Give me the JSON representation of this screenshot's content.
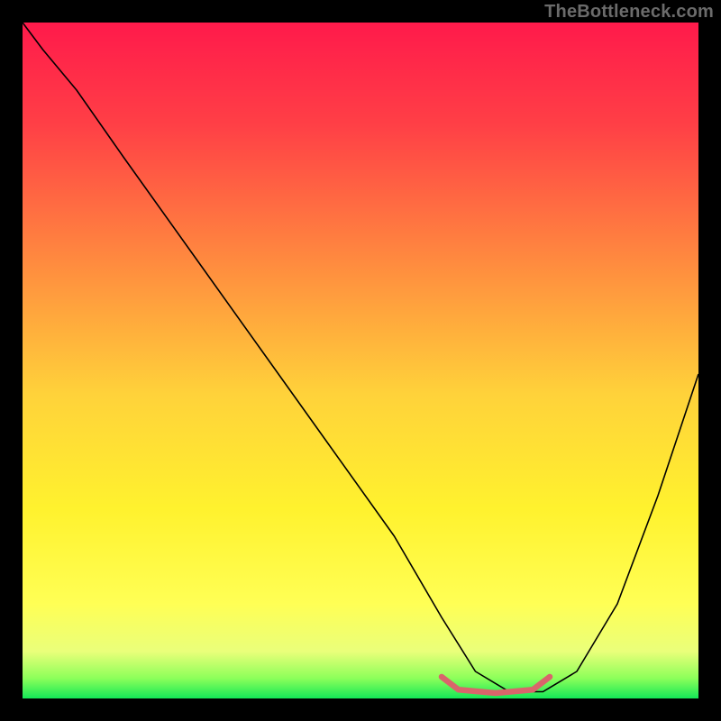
{
  "watermark": "TheBottleneck.com",
  "chart_data": {
    "type": "line",
    "title": "",
    "xlabel": "",
    "ylabel": "",
    "xlim": [
      0,
      100
    ],
    "ylim": [
      0,
      100
    ],
    "gradient_stops": [
      {
        "offset": 0,
        "color": "#ff1a4b"
      },
      {
        "offset": 15,
        "color": "#ff3f46"
      },
      {
        "offset": 35,
        "color": "#ff893f"
      },
      {
        "offset": 55,
        "color": "#ffd23a"
      },
      {
        "offset": 72,
        "color": "#fff22e"
      },
      {
        "offset": 86,
        "color": "#ffff55"
      },
      {
        "offset": 93,
        "color": "#eaff7a"
      },
      {
        "offset": 97,
        "color": "#8dff5a"
      },
      {
        "offset": 100,
        "color": "#14e857"
      }
    ],
    "series": [
      {
        "name": "bottleneck-curve",
        "color": "#000000",
        "width": 1.6,
        "x": [
          0,
          3,
          8,
          15,
          25,
          35,
          45,
          55,
          62,
          67,
          72,
          77,
          82,
          88,
          94,
          100
        ],
        "y": [
          100,
          96,
          90,
          80,
          66,
          52,
          38,
          24,
          12,
          4,
          1,
          1,
          4,
          14,
          30,
          48
        ]
      },
      {
        "name": "sweet-spot-marker",
        "color": "#d9656b",
        "width": 6.5,
        "linecap": "round",
        "x": [
          62,
          64.5,
          70,
          75.5,
          78
        ],
        "y": [
          3.2,
          1.3,
          0.8,
          1.3,
          3.2
        ]
      }
    ]
  }
}
